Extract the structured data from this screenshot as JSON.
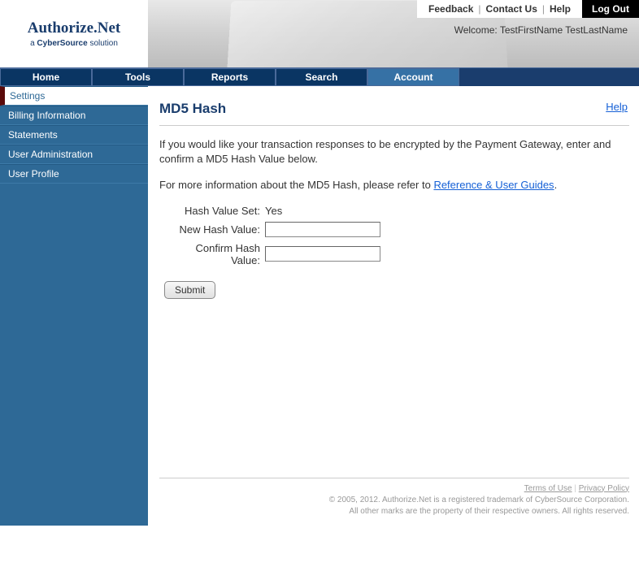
{
  "header": {
    "logo_main": "Authorize.Net",
    "logo_sub_prefix": "a ",
    "logo_sub_bold": "CyberSource",
    "logo_sub_suffix": " solution",
    "top_links": {
      "feedback": "Feedback",
      "contact": "Contact Us",
      "help": "Help",
      "logout": "Log Out"
    },
    "welcome_prefix": "Welcome: ",
    "welcome_name": "TestFirstName TestLastName"
  },
  "nav": {
    "home": "Home",
    "tools": "Tools",
    "reports": "Reports",
    "search": "Search",
    "account": "Account"
  },
  "sidebar": {
    "items": [
      {
        "label": "Settings",
        "active": true
      },
      {
        "label": "Billing Information",
        "active": false
      },
      {
        "label": "Statements",
        "active": false
      },
      {
        "label": "User Administration",
        "active": false
      },
      {
        "label": "User Profile",
        "active": false
      }
    ]
  },
  "main": {
    "title": "MD5 Hash",
    "help": "Help",
    "intro1": "If you would like your transaction responses to be encrypted by the Payment Gateway, enter and confirm a MD5 Hash Value below.",
    "intro2_prefix": "For more information about the MD5 Hash, please refer to ",
    "intro2_link": "Reference & User Guides",
    "intro2_suffix": ".",
    "form": {
      "hash_set_label": "Hash Value Set:",
      "hash_set_value": "Yes",
      "new_hash_label": "New Hash Value:",
      "confirm_hash_label": "Confirm Hash Value:",
      "new_hash_value": "",
      "confirm_hash_value": "",
      "submit": "Submit"
    }
  },
  "footer": {
    "terms": "Terms of Use",
    "privacy": "Privacy Policy",
    "copyright": "© 2005, 2012. Authorize.Net is a registered trademark of CyberSource Corporation.",
    "marks": "All other marks are the property of their respective owners. All rights reserved."
  }
}
